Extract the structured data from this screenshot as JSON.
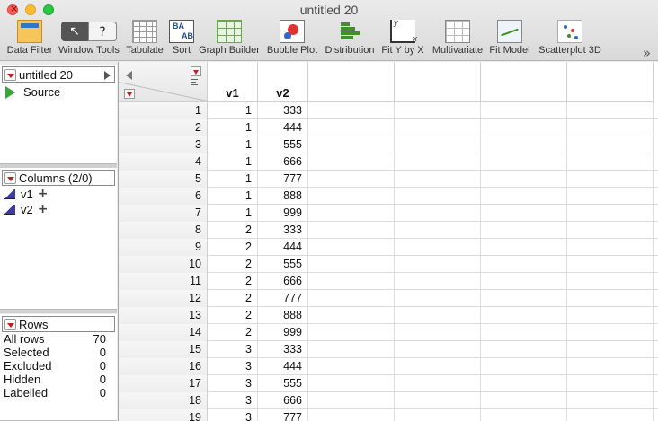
{
  "window": {
    "title": "untitled 20"
  },
  "toolbar": {
    "items": [
      {
        "label": "Data Filter",
        "icon": "data-filter-icon"
      },
      {
        "label": "Window Tools",
        "icon": "window-tools-icon",
        "arrow": "↖",
        "q": "?"
      },
      {
        "label": "Tabulate",
        "icon": "tabulate-icon"
      },
      {
        "label": "Sort",
        "icon": "sort-icon"
      },
      {
        "label": "Graph Builder",
        "icon": "graph-builder-icon"
      },
      {
        "label": "Bubble Plot",
        "icon": "bubble-plot-icon"
      },
      {
        "label": "Distribution",
        "icon": "distribution-icon"
      },
      {
        "label": "Fit Y by X",
        "icon": "fit-y-by-x-icon"
      },
      {
        "label": "Multivariate",
        "icon": "multivariate-icon"
      },
      {
        "label": "Fit Model",
        "icon": "fit-model-icon"
      },
      {
        "label": "Scatterplot 3D",
        "icon": "scatterplot-3d-icon"
      }
    ],
    "more": "»"
  },
  "table_panel": {
    "title": "untitled 20",
    "source_label": "Source"
  },
  "columns_panel": {
    "title": "Columns (2/0)",
    "items": [
      "v1",
      "v2"
    ]
  },
  "rows_panel": {
    "title": "Rows",
    "stats": [
      {
        "label": "All rows",
        "value": "70"
      },
      {
        "label": "Selected",
        "value": "0"
      },
      {
        "label": "Excluded",
        "value": "0"
      },
      {
        "label": "Hidden",
        "value": "0"
      },
      {
        "label": "Labelled",
        "value": "0"
      }
    ]
  },
  "grid": {
    "headers": [
      "v1",
      "v2"
    ],
    "rows": [
      [
        "1",
        "1",
        "333"
      ],
      [
        "2",
        "1",
        "444"
      ],
      [
        "3",
        "1",
        "555"
      ],
      [
        "4",
        "1",
        "666"
      ],
      [
        "5",
        "1",
        "777"
      ],
      [
        "6",
        "1",
        "888"
      ],
      [
        "7",
        "1",
        "999"
      ],
      [
        "8",
        "2",
        "333"
      ],
      [
        "9",
        "2",
        "444"
      ],
      [
        "10",
        "2",
        "555"
      ],
      [
        "11",
        "2",
        "666"
      ],
      [
        "12",
        "2",
        "777"
      ],
      [
        "13",
        "2",
        "888"
      ],
      [
        "14",
        "2",
        "999"
      ],
      [
        "15",
        "3",
        "333"
      ],
      [
        "16",
        "3",
        "444"
      ],
      [
        "17",
        "3",
        "555"
      ],
      [
        "18",
        "3",
        "666"
      ],
      [
        "19",
        "3",
        "777"
      ]
    ]
  }
}
